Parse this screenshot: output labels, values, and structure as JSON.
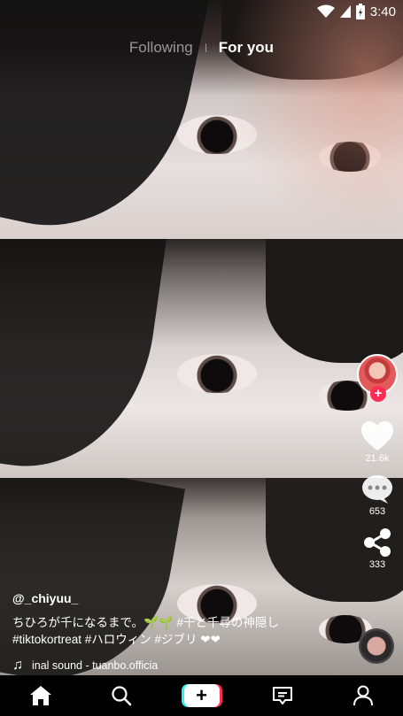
{
  "status_bar": {
    "time": "3:40"
  },
  "feed_tabs": {
    "following": "Following",
    "for_you": "For you"
  },
  "post": {
    "username": "@_chiyuu_",
    "description_line1": "ちひろが千になるまで。🌱🌱 #千と千尋の神隠し",
    "description_line2": "#tiktokortreat #ハロウィン #ジブリ ❤❤",
    "sound": "inal sound - tuanbo.officia"
  },
  "actions": {
    "likes": "21.6k",
    "comments": "653",
    "shares": "333"
  },
  "colors": {
    "accent_red": "#fe2c55",
    "accent_cyan": "#25f4ee"
  },
  "icons": {
    "follow_plus": "+",
    "create_plus": "+",
    "music_note": "♫"
  }
}
